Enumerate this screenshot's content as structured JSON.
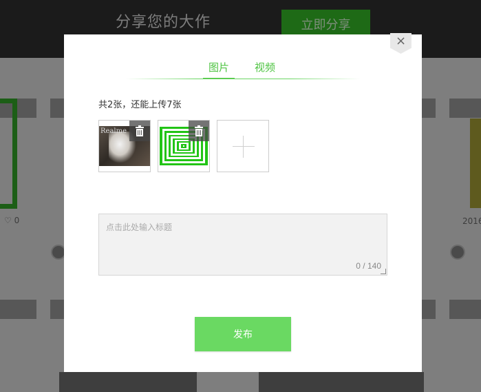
{
  "background": {
    "tagline": "分享您的大作",
    "share_button": "立即分享",
    "like_count": "0",
    "date_fragment": "2016"
  },
  "modal": {
    "close_label": "×",
    "tabs": [
      {
        "label": "图片",
        "active": true
      },
      {
        "label": "视频",
        "active": false
      }
    ],
    "upload_info": "共2张，还能上传7张",
    "thumbnails": [
      {
        "name": "uploaded-photo",
        "logo_text": "Realme"
      },
      {
        "name": "uploaded-green-squares"
      }
    ],
    "title_input": {
      "placeholder": "点击此处输入标题",
      "value": "",
      "char_count": "0 / 140"
    },
    "publish_label": "发布"
  },
  "colors": {
    "accent": "#4fc443",
    "button": "#6ad962"
  }
}
